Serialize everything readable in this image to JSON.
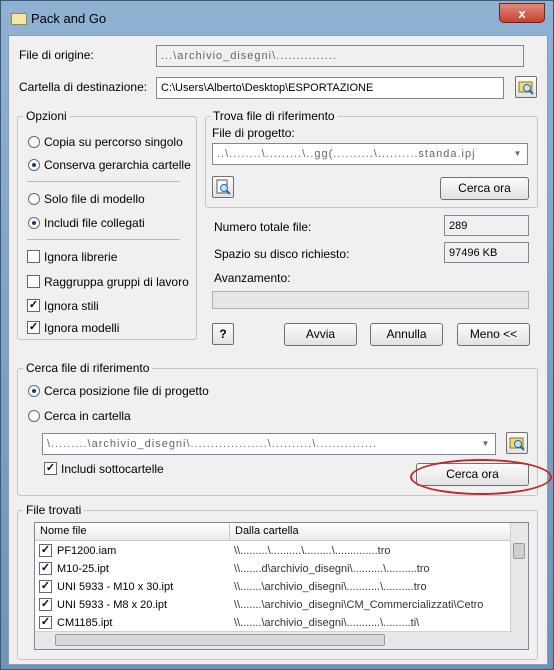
{
  "window": {
    "title": "Pack and Go",
    "close_glyph": "x"
  },
  "source": {
    "label": "File di origine:",
    "value": "...\\archivio_disegni\\..............."
  },
  "destination": {
    "label": "Cartella di destinazione:",
    "value": "C:\\Users\\Alberto\\Desktop\\ESPORTAZIONE"
  },
  "options": {
    "title": "Opzioni",
    "copy_single": "Copia su percorso singolo",
    "keep_hierarchy": "Conserva gerarchia cartelle",
    "only_model": "Solo file di modello",
    "include_linked": "Includi file collegati",
    "ignore_libraries": "Ignora librerie",
    "group_workgroups": "Raggruppa gruppi di lavoro",
    "ignore_styles": "Ignora stili",
    "ignore_models": "Ignora modelli"
  },
  "find_ref": {
    "title": "Trova file di riferimento",
    "project_label": "File di progetto:",
    "project_value": "..\\........\\.........\\..gg(..........\\..........standa.ipj",
    "search_button": "Cerca ora"
  },
  "stats": {
    "total_files_label": "Numero totale file:",
    "total_files_value": "289",
    "disk_space_label": "Spazio su disco richiesto:",
    "disk_space_value": "97496 KB",
    "progress_label": "Avanzamento:",
    "progress": 0
  },
  "actions": {
    "run": "Avvia",
    "cancel": "Annulla",
    "less": "Meno <<",
    "help_glyph": "?"
  },
  "search_ref": {
    "title": "Cerca file di riferimento",
    "project_location": "Cerca posizione file di progetto",
    "in_folder": "Cerca in cartella",
    "folder_value": "\\.........\\archivio_disegni\\...................\\..........\\...............",
    "include_subfolders": "Includi sottocartelle",
    "search_button": "Cerca ora"
  },
  "found": {
    "title": "File trovati",
    "columns": [
      "Nome file",
      "Dalla cartella"
    ],
    "rows": [
      {
        "name": "PF1200.iam",
        "folder": "\\\\.........\\..........\\.........\\..............tro"
      },
      {
        "name": "M10-25.ipt",
        "folder": "\\\\.......d\\archivio_disegni\\..........\\..........tro"
      },
      {
        "name": "UNI 5933 - M10 x 30.ipt",
        "folder": "\\\\.......\\archivio_disegni\\...........\\..........tro"
      },
      {
        "name": "UNI 5933 - M8 x 20.ipt",
        "folder": "\\\\.......\\archivio_disegni\\CM_Commercializzati\\Cetro"
      },
      {
        "name": "CM1185.ipt",
        "folder": "\\\\.......\\archivio_disegni\\...........\\.........ti\\"
      }
    ]
  }
}
